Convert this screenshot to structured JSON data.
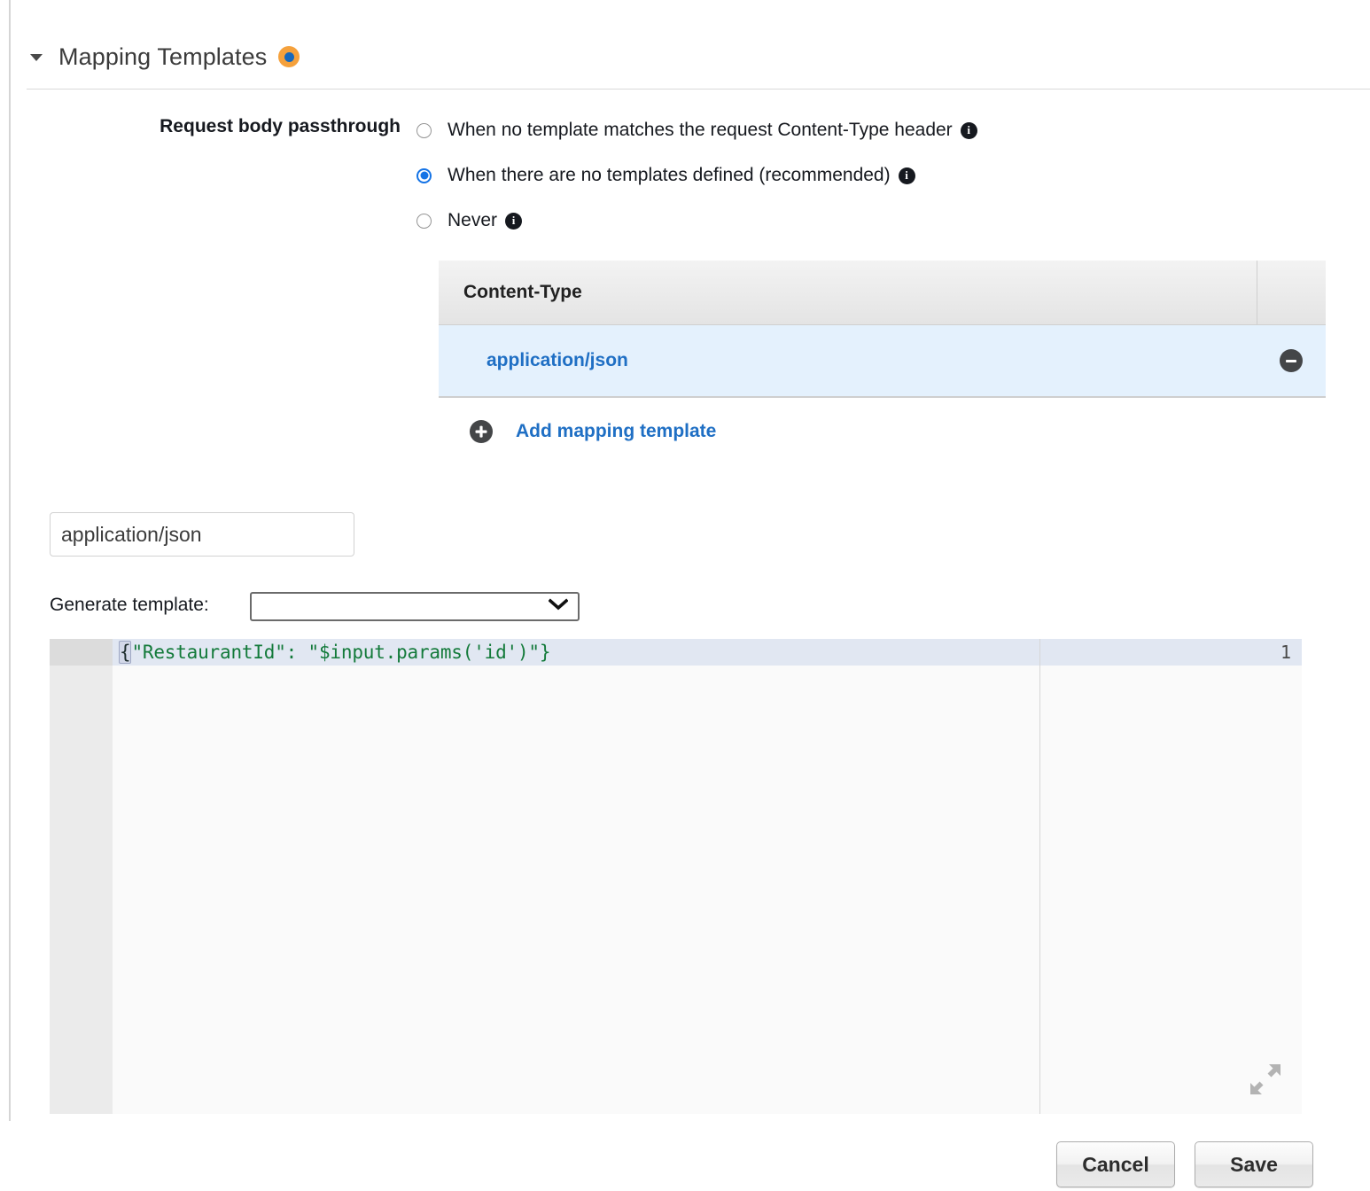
{
  "section": {
    "title": "Mapping Templates",
    "caret_icon": "caret-down-icon",
    "badge_icon": "status-dot-icon",
    "badge_outer_color": "#f5a13c",
    "badge_inner_color": "#1568bd"
  },
  "passthrough": {
    "label": "Request body passthrough",
    "info_glyph": "i",
    "options": [
      {
        "label": "When no template matches the request Content-Type header",
        "checked": false,
        "has_info": true
      },
      {
        "label": "When there are no templates defined (recommended)",
        "checked": true,
        "has_info": true
      },
      {
        "label": "Never",
        "checked": true,
        "has_info": true
      }
    ]
  },
  "content_type_table": {
    "columns": [
      "Content-Type",
      ""
    ],
    "rows": [
      {
        "content_type": "application/json",
        "remove_icon": "minus-circle-icon",
        "selected": true
      }
    ],
    "add_link": "Add mapping template",
    "add_icon": "plus-circle-icon",
    "link_color": "#1f6fc4",
    "selected_row_color": "#e4f1fd"
  },
  "content_type_field": {
    "value": "application/json",
    "placeholder": "Content-Type"
  },
  "generate_template": {
    "label": "Generate template:",
    "selected": "",
    "options": [
      ""
    ],
    "chevron_icon": "chevron-down-icon"
  },
  "editor": {
    "line_number": "1",
    "code_open_brace": "{",
    "code_body": "\"RestaurantId\": \"$input.params('id')\"}",
    "full_code": "{\"RestaurantId\": \"$input.params('id')\"}",
    "string_color": "#137a3a",
    "active_line_color": "#e1e7f2",
    "expand_icon": "expand-arrows-icon"
  },
  "footer": {
    "cancel_label": "Cancel",
    "save_label": "Save"
  }
}
